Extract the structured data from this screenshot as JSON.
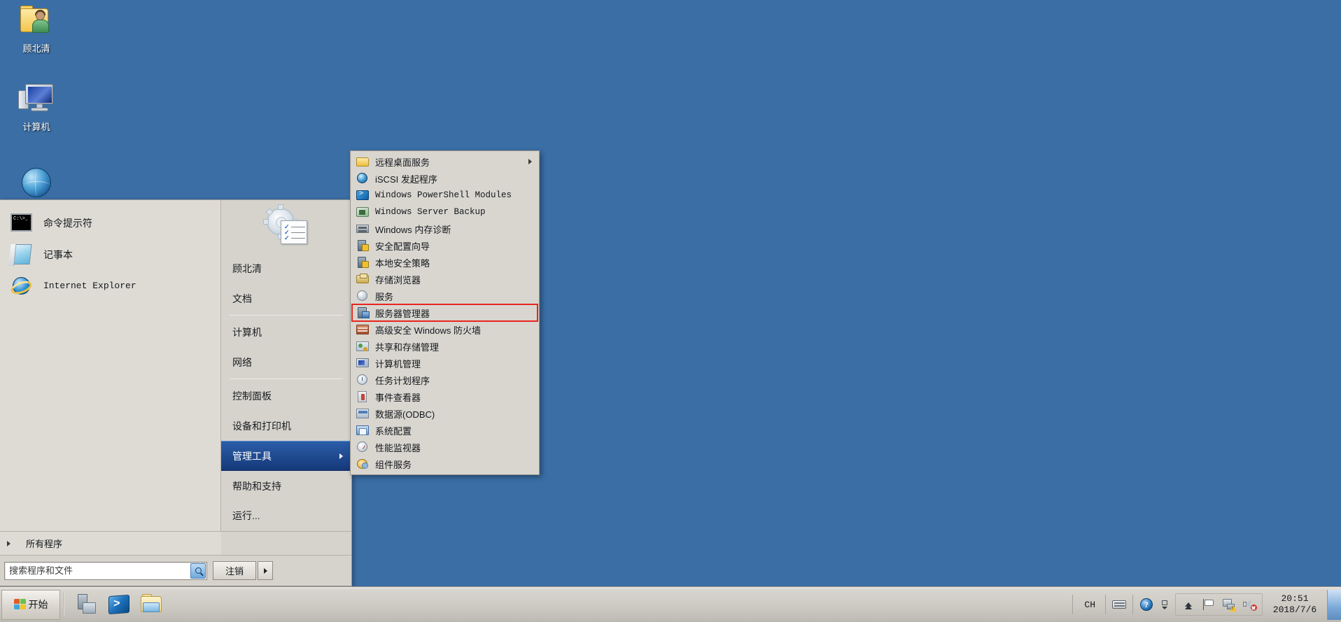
{
  "desktop": {
    "icons": [
      {
        "label": "顾北清",
        "icon": "user-folder-icon"
      },
      {
        "label": "计算机",
        "icon": "computer-icon"
      },
      {
        "label": "",
        "icon": "internet-explorer-icon"
      }
    ]
  },
  "start_menu": {
    "pinned": [
      {
        "label": "命令提示符",
        "icon": "command-prompt-icon",
        "mono": false
      },
      {
        "label": "记事本",
        "icon": "notepad-icon",
        "mono": false
      },
      {
        "label": "Internet Explorer",
        "icon": "internet-explorer-icon",
        "mono": true
      }
    ],
    "user_picture_icon": "administrative-tools-icon",
    "right_items": [
      {
        "label": "顾北清",
        "sep_after": false,
        "selected": false,
        "arrow": false
      },
      {
        "label": "文档",
        "sep_after": true,
        "selected": false,
        "arrow": false
      },
      {
        "label": "计算机",
        "sep_after": false,
        "selected": false,
        "arrow": false
      },
      {
        "label": "网络",
        "sep_after": true,
        "selected": false,
        "arrow": false
      },
      {
        "label": "控制面板",
        "sep_after": false,
        "selected": false,
        "arrow": false
      },
      {
        "label": "设备和打印机",
        "sep_after": false,
        "selected": false,
        "arrow": false
      },
      {
        "label": "管理工具",
        "sep_after": false,
        "selected": true,
        "arrow": true
      },
      {
        "label": "帮助和支持",
        "sep_after": false,
        "selected": false,
        "arrow": false
      },
      {
        "label": "运行...",
        "sep_after": false,
        "selected": false,
        "arrow": false
      }
    ],
    "all_programs_label": "所有程序",
    "search_placeholder": "搜索程序和文件",
    "search_value": "",
    "search_button_icon": "search-icon",
    "logoff_label": "注销"
  },
  "submenu": {
    "title": "管理工具",
    "highlight_color": "#e8251f",
    "items": [
      {
        "label": "远程桌面服务",
        "icon": "folder-icon",
        "mono": false,
        "arrow": true,
        "highlighted": false
      },
      {
        "label": "iSCSI 发起程序",
        "icon": "globe-icon",
        "mono": false,
        "arrow": false,
        "highlighted": false
      },
      {
        "label": "Windows PowerShell Modules",
        "icon": "powershell-icon",
        "mono": true,
        "arrow": false,
        "highlighted": false
      },
      {
        "label": "Windows Server Backup",
        "icon": "backup-icon",
        "mono": true,
        "arrow": false,
        "highlighted": false
      },
      {
        "label": "Windows 内存诊断",
        "icon": "memory-diagnostic-icon",
        "mono": false,
        "arrow": false,
        "highlighted": false
      },
      {
        "label": "安全配置向导",
        "icon": "security-config-icon",
        "mono": false,
        "arrow": false,
        "highlighted": false
      },
      {
        "label": "本地安全策略",
        "icon": "local-security-policy-icon",
        "mono": false,
        "arrow": false,
        "highlighted": false
      },
      {
        "label": "存储浏览器",
        "icon": "storage-explorer-icon",
        "mono": false,
        "arrow": false,
        "highlighted": false
      },
      {
        "label": "服务",
        "icon": "services-icon",
        "mono": false,
        "arrow": false,
        "highlighted": false
      },
      {
        "label": "服务器管理器",
        "icon": "server-manager-icon",
        "mono": false,
        "arrow": false,
        "highlighted": true
      },
      {
        "label": "高级安全 Windows 防火墙",
        "icon": "firewall-icon",
        "mono": false,
        "arrow": false,
        "highlighted": false
      },
      {
        "label": "共享和存储管理",
        "icon": "share-storage-icon",
        "mono": false,
        "arrow": false,
        "highlighted": false
      },
      {
        "label": "计算机管理",
        "icon": "computer-management-icon",
        "mono": false,
        "arrow": false,
        "highlighted": false
      },
      {
        "label": "任务计划程序",
        "icon": "task-scheduler-icon",
        "mono": false,
        "arrow": false,
        "highlighted": false
      },
      {
        "label": "事件查看器",
        "icon": "event-viewer-icon",
        "mono": false,
        "arrow": false,
        "highlighted": false
      },
      {
        "label": "数据源(ODBC)",
        "icon": "odbc-icon",
        "mono": false,
        "arrow": false,
        "highlighted": false
      },
      {
        "label": "系统配置",
        "icon": "system-config-icon",
        "mono": false,
        "arrow": false,
        "highlighted": false
      },
      {
        "label": "性能监视器",
        "icon": "performance-monitor-icon",
        "mono": false,
        "arrow": false,
        "highlighted": false
      },
      {
        "label": "组件服务",
        "icon": "component-services-icon",
        "mono": false,
        "arrow": false,
        "highlighted": false
      }
    ]
  },
  "taskbar": {
    "start_label": "开始",
    "quick_launch": [
      {
        "name": "server-manager-taskbar-icon"
      },
      {
        "name": "powershell-taskbar-icon"
      },
      {
        "name": "explorer-taskbar-icon"
      }
    ],
    "tray": {
      "ime_label": "CH",
      "icons": [
        "keyboard-icon",
        "help-icon",
        "ime-options-icon",
        "chevron-up-icon",
        "flag-icon",
        "network-warning-icon",
        "speaker-muted-icon"
      ],
      "time": "20:51",
      "date": "2018/7/6"
    }
  },
  "colors": {
    "desktop_background": "#3a6ea5",
    "menu_background": "#d6d3cd",
    "selection_blue": "#1c4b94",
    "highlight_red": "#e8251f"
  }
}
